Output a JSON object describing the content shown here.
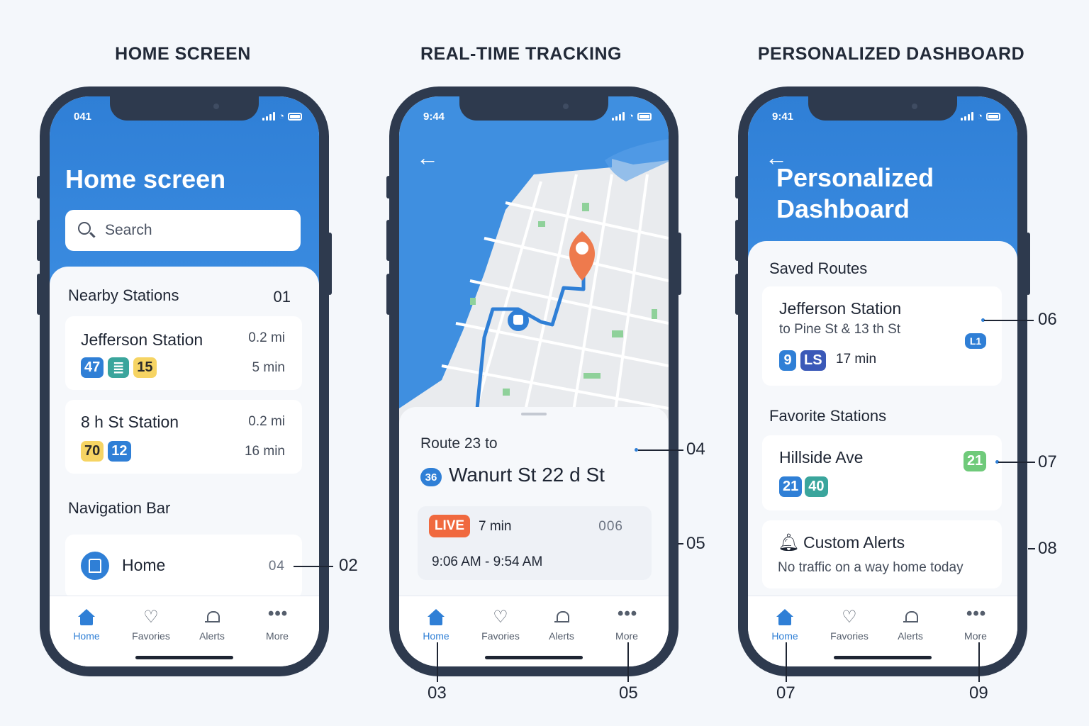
{
  "headings": [
    "HOME SCREEN",
    "REAL-TIME TRACKING",
    "PERSONALIZED DASHBOARD"
  ],
  "colors": {
    "primary": "#2f7fd6",
    "live": "#f0693f",
    "map_water": "#3f8fe0",
    "map_land": "#e9ebee",
    "pin": "#ee7a4d"
  },
  "tabs": [
    {
      "label": "Home",
      "icon": "home-icon"
    },
    {
      "label": "Favories",
      "icon": "heart-icon"
    },
    {
      "label": "Alerts",
      "icon": "bell-icon"
    },
    {
      "label": "More",
      "icon": "more-dots-icon"
    }
  ],
  "home": {
    "time": "041",
    "title": "Home screen",
    "search_placeholder": "Search",
    "nearby_title": "Nearby Stations",
    "nearby_num": "01",
    "stations": [
      {
        "name": "Jefferson Station",
        "dist": "0.2 mi",
        "eta": "5 min",
        "badges": [
          "47",
          "≣",
          "15"
        ]
      },
      {
        "name": "8 h St Station",
        "dist": "0.2 mi",
        "eta": "16 min",
        "badges": [
          "70",
          "12"
        ]
      }
    ],
    "nav_title": "Navigation Bar",
    "nav_item": "Home",
    "nav_num": "04",
    "callout": "02"
  },
  "tracking": {
    "time": "9:44",
    "route_prefix": "Route 23 to",
    "route_badge": "36",
    "route_dest": "Wanurt St 22 d St",
    "live": "LIVE",
    "live_eta": "7 min",
    "vehicle": "006",
    "times": "9:06 AM - 9:54 AM",
    "callouts": [
      "04",
      "05",
      "03",
      "05"
    ]
  },
  "dashboard": {
    "time": "9:41",
    "title_line1": "Personalized",
    "title_line2": "Dashboard",
    "saved_title": "Saved Routes",
    "saved": {
      "name": "Jefferson Station",
      "sub": "to Pine St & 13 th St",
      "badges": [
        "9",
        "LS"
      ],
      "eta": "17 min",
      "tag": "L1"
    },
    "fav_title": "Favorite Stations",
    "fav": {
      "name": "Hillside Ave",
      "badges": [
        "21",
        "40"
      ],
      "tag": "21"
    },
    "alerts_title": "Custom Alerts",
    "alerts_text": "No traffic on a way home today",
    "callouts": [
      "06",
      "07",
      "08",
      "07",
      "09"
    ]
  }
}
